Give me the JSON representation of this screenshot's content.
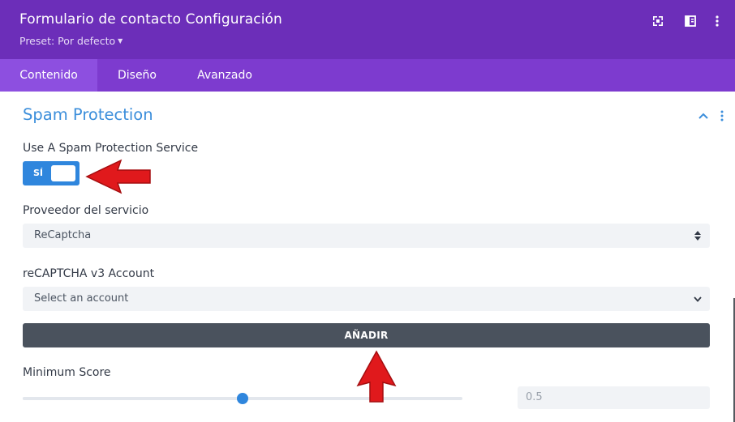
{
  "header": {
    "title": "Formulario de contacto Configuración",
    "preset_label": "Preset: Por defecto",
    "icons": [
      "expand-icon",
      "split-view-icon",
      "more-vertical-icon"
    ],
    "background": "#6c2eb9"
  },
  "tabs": [
    {
      "label": "Contenido",
      "active": true
    },
    {
      "label": "Diseño",
      "active": false
    },
    {
      "label": "Avanzado",
      "active": false
    }
  ],
  "section": {
    "title": "Spam Protection",
    "icons": [
      "chevron-up-icon",
      "more-vertical-icon"
    ]
  },
  "spam_service": {
    "label": "Use A Spam Protection Service",
    "toggle_text": "SÍ",
    "enabled": true
  },
  "provider": {
    "label": "Proveedor del servicio",
    "value": "ReCaptcha"
  },
  "account": {
    "label": "reCAPTCHA v3 Account",
    "value": "Select an account"
  },
  "add_button": {
    "label": "AÑADIR"
  },
  "minimum_score": {
    "label": "Minimum Score",
    "value": "0.5",
    "fraction": 0.5
  },
  "colors": {
    "accent": "#2f86dd",
    "section_title": "#3b8edb",
    "annotation_arrow": "#e0191c"
  }
}
